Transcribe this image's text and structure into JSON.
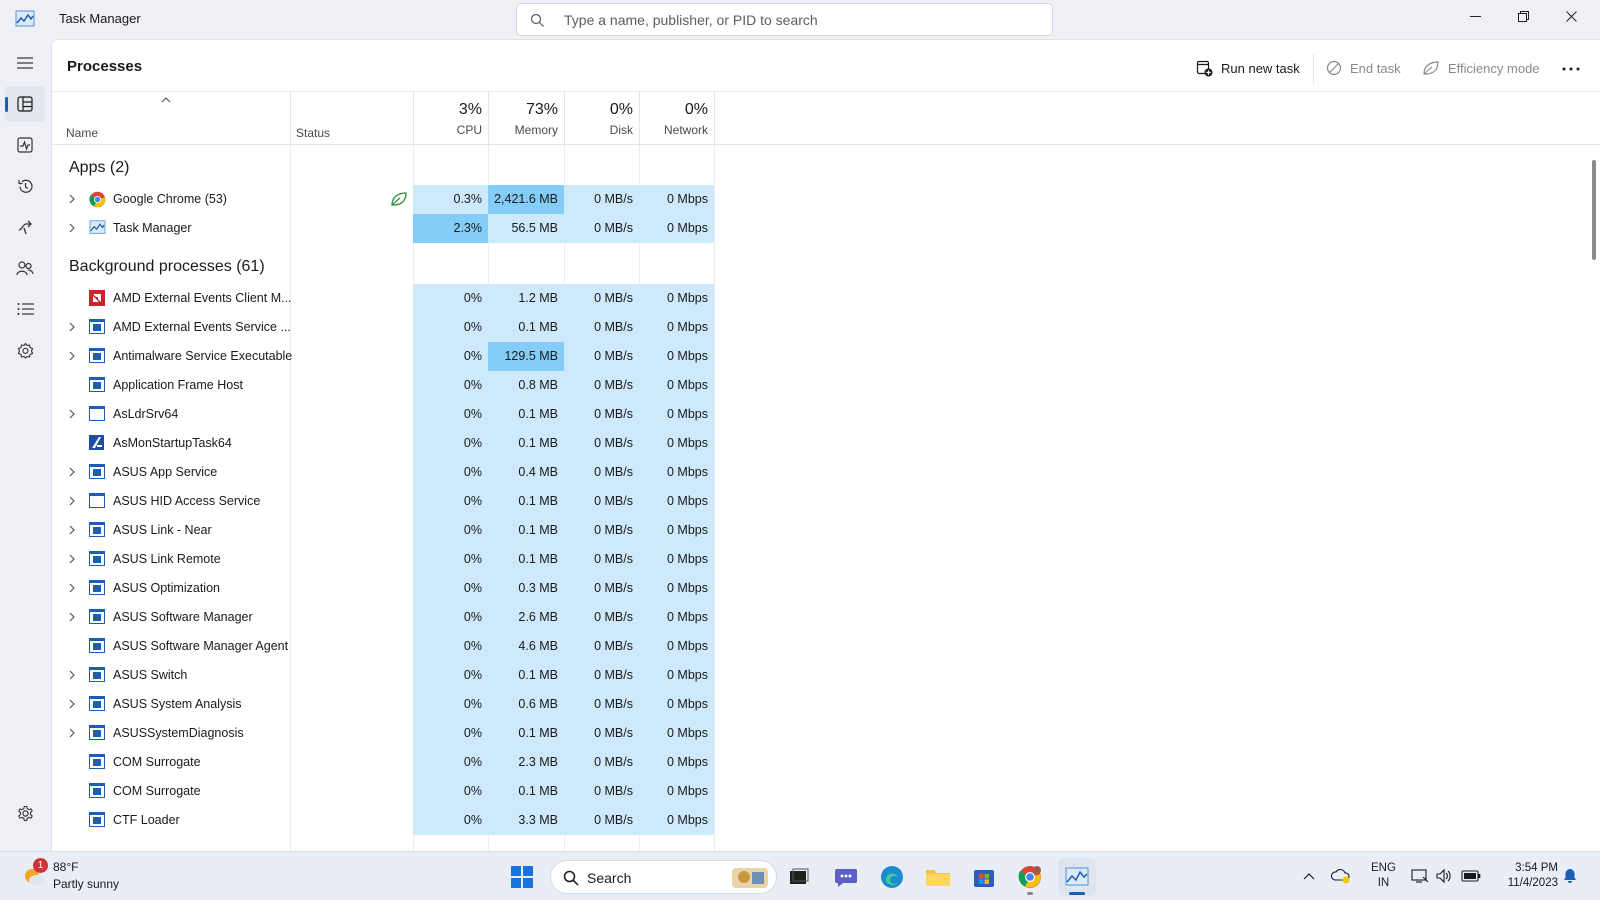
{
  "window": {
    "title": "Task Manager",
    "search_placeholder": "Type a name, publisher, or PID to search"
  },
  "page": {
    "title": "Processes",
    "commands": {
      "run_new_task": "Run new task",
      "end_task": "End task",
      "efficiency_mode": "Efficiency mode"
    }
  },
  "columns": {
    "name": "Name",
    "status": "Status",
    "cpu": {
      "pct": "3%",
      "label": "CPU"
    },
    "memory": {
      "pct": "73%",
      "label": "Memory"
    },
    "disk": {
      "pct": "0%",
      "label": "Disk"
    },
    "network": {
      "pct": "0%",
      "label": "Network"
    }
  },
  "sections": {
    "apps": "Apps (2)",
    "background": "Background processes (61)"
  },
  "apps": [
    {
      "name": "Google Chrome (53)",
      "icon": "chrome-icon",
      "expand": true,
      "status_icon": "efficiency-leaf-icon",
      "cpu": "0.3%",
      "memory": "2,421.6 MB",
      "disk": "0 MB/s",
      "network": "0 Mbps",
      "cpu_hl": "hl1",
      "mem_hl": "hl2"
    },
    {
      "name": "Task Manager",
      "icon": "task-manager-icon",
      "expand": true,
      "cpu": "2.3%",
      "memory": "56.5 MB",
      "disk": "0 MB/s",
      "network": "0 Mbps",
      "cpu_hl": "hl2",
      "mem_hl": "hl1"
    }
  ],
  "background": [
    {
      "name": "AMD External Events Client M...",
      "icon": "amd-icon",
      "expand": false,
      "cpu": "0%",
      "memory": "1.2 MB",
      "disk": "0 MB/s",
      "network": "0 Mbps"
    },
    {
      "name": "AMD External Events Service ...",
      "icon": "service-window-icon",
      "expand": true,
      "cpu": "0%",
      "memory": "0.1 MB",
      "disk": "0 MB/s",
      "network": "0 Mbps"
    },
    {
      "name": "Antimalware Service Executable",
      "icon": "service-window-icon",
      "expand": true,
      "cpu": "0%",
      "memory": "129.5 MB",
      "disk": "0 MB/s",
      "network": "0 Mbps",
      "mem_hl": "hl2"
    },
    {
      "name": "Application Frame Host",
      "icon": "service-window-icon",
      "expand": false,
      "cpu": "0%",
      "memory": "0.8 MB",
      "disk": "0 MB/s",
      "network": "0 Mbps"
    },
    {
      "name": "AsLdrSrv64",
      "icon": "blank-window-icon",
      "expand": true,
      "cpu": "0%",
      "memory": "0.1 MB",
      "disk": "0 MB/s",
      "network": "0 Mbps"
    },
    {
      "name": "AsMonStartupTask64",
      "icon": "asus-icon",
      "expand": false,
      "cpu": "0%",
      "memory": "0.1 MB",
      "disk": "0 MB/s",
      "network": "0 Mbps"
    },
    {
      "name": "ASUS App Service",
      "icon": "service-window-icon",
      "expand": true,
      "cpu": "0%",
      "memory": "0.4 MB",
      "disk": "0 MB/s",
      "network": "0 Mbps"
    },
    {
      "name": "ASUS HID Access Service",
      "icon": "blank-window-icon",
      "expand": true,
      "cpu": "0%",
      "memory": "0.1 MB",
      "disk": "0 MB/s",
      "network": "0 Mbps"
    },
    {
      "name": "ASUS Link - Near",
      "icon": "service-window-icon",
      "expand": true,
      "cpu": "0%",
      "memory": "0.1 MB",
      "disk": "0 MB/s",
      "network": "0 Mbps"
    },
    {
      "name": "ASUS Link Remote",
      "icon": "service-window-icon",
      "expand": true,
      "cpu": "0%",
      "memory": "0.1 MB",
      "disk": "0 MB/s",
      "network": "0 Mbps"
    },
    {
      "name": "ASUS Optimization",
      "icon": "service-window-icon",
      "expand": true,
      "cpu": "0%",
      "memory": "0.3 MB",
      "disk": "0 MB/s",
      "network": "0 Mbps"
    },
    {
      "name": "ASUS Software Manager",
      "icon": "service-window-icon",
      "expand": true,
      "cpu": "0%",
      "memory": "2.6 MB",
      "disk": "0 MB/s",
      "network": "0 Mbps"
    },
    {
      "name": "ASUS Software Manager Agent",
      "icon": "service-window-icon",
      "expand": false,
      "cpu": "0%",
      "memory": "4.6 MB",
      "disk": "0 MB/s",
      "network": "0 Mbps"
    },
    {
      "name": "ASUS Switch",
      "icon": "service-window-icon",
      "expand": true,
      "cpu": "0%",
      "memory": "0.1 MB",
      "disk": "0 MB/s",
      "network": "0 Mbps"
    },
    {
      "name": "ASUS System Analysis",
      "icon": "service-window-icon",
      "expand": true,
      "cpu": "0%",
      "memory": "0.6 MB",
      "disk": "0 MB/s",
      "network": "0 Mbps"
    },
    {
      "name": "ASUSSystemDiagnosis",
      "icon": "service-window-icon",
      "expand": true,
      "cpu": "0%",
      "memory": "0.1 MB",
      "disk": "0 MB/s",
      "network": "0 Mbps"
    },
    {
      "name": "COM Surrogate",
      "icon": "service-window-icon",
      "expand": false,
      "cpu": "0%",
      "memory": "2.3 MB",
      "disk": "0 MB/s",
      "network": "0 Mbps"
    },
    {
      "name": "COM Surrogate",
      "icon": "service-window-icon",
      "expand": false,
      "cpu": "0%",
      "memory": "0.1 MB",
      "disk": "0 MB/s",
      "network": "0 Mbps"
    },
    {
      "name": "CTF Loader",
      "icon": "service-window-icon",
      "expand": false,
      "cpu": "0%",
      "memory": "3.3 MB",
      "disk": "0 MB/s",
      "network": "0 Mbps"
    }
  ],
  "nav": [
    "hamburger-icon",
    "processes-icon",
    "performance-icon",
    "app-history-icon",
    "startup-apps-icon",
    "users-icon",
    "details-icon",
    "services-icon",
    "settings-icon"
  ],
  "taskbar": {
    "weather_temp": "88°F",
    "weather_desc": "Partly sunny",
    "weather_badge": "1",
    "search_label": "Search",
    "lang_top": "ENG",
    "lang_bottom": "IN",
    "time": "3:54 PM",
    "date": "11/4/2023"
  },
  "colors": {
    "accent": "#1a5fb4",
    "cell_low": "#cde9fb",
    "cell_high": "#84cdf7"
  }
}
